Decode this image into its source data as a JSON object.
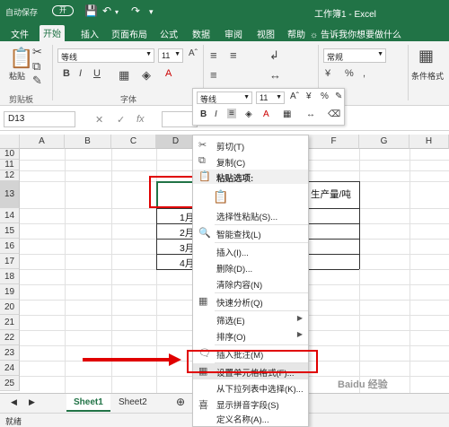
{
  "titlebar": {
    "autosave": "自动保存",
    "toggle": "开",
    "doc_title": "工作簿1 - Excel"
  },
  "tabs": [
    {
      "label": "文件"
    },
    {
      "label": "开始"
    },
    {
      "label": "插入"
    },
    {
      "label": "页面布局"
    },
    {
      "label": "公式"
    },
    {
      "label": "数据"
    },
    {
      "label": "审阅"
    },
    {
      "label": "视图"
    },
    {
      "label": "帮助"
    }
  ],
  "tellme": "告诉我你想要做什么",
  "ribbon": {
    "paste": "粘贴",
    "clipboard": "剪贴板",
    "font_name": "等线",
    "font_size": "11",
    "font_group": "字体",
    "number_format": "常规",
    "cond_format": "条件格式"
  },
  "formula": {
    "namebox": "D13",
    "fx": "fx"
  },
  "columns": [
    "A",
    "B",
    "C",
    "D",
    "E",
    "F",
    "G",
    "H"
  ],
  "rows": [
    "10",
    "11",
    "12",
    "13",
    "14",
    "15",
    "16",
    "17",
    "18",
    "19",
    "20",
    "21",
    "22",
    "23",
    "24",
    "25",
    "26",
    "27"
  ],
  "cells": {
    "f13": "生产量/吨",
    "d14": "1月",
    "d15": "2月",
    "d16": "3月",
    "d17": "4月"
  },
  "mini_toolbar": {
    "font_name": "等线",
    "font_size": "11",
    "bold": "B",
    "italic": "I"
  },
  "context_menu": {
    "cut": "剪切(T)",
    "copy": "复制(C)",
    "paste_options": "粘贴选项:",
    "paste_special": "选择性粘贴(S)...",
    "smart_lookup": "智能查找(L)",
    "insert": "插入(I)...",
    "delete": "删除(D)...",
    "clear": "清除内容(N)",
    "quick_analysis": "快速分析(Q)",
    "filter": "筛选(E)",
    "sort": "排序(O)",
    "insert_comment": "插入批注(M)",
    "format_cells": "设置单元格格式(F)...",
    "pick_list": "从下拉列表中选择(K)...",
    "phonetic": "显示拼音字段(S)",
    "define_name": "定义名称(A)...",
    "link": "链接(I)"
  },
  "sheets": [
    "Sheet1",
    "Sheet2"
  ],
  "status": "就绪",
  "watermark": "Baidu 经验"
}
